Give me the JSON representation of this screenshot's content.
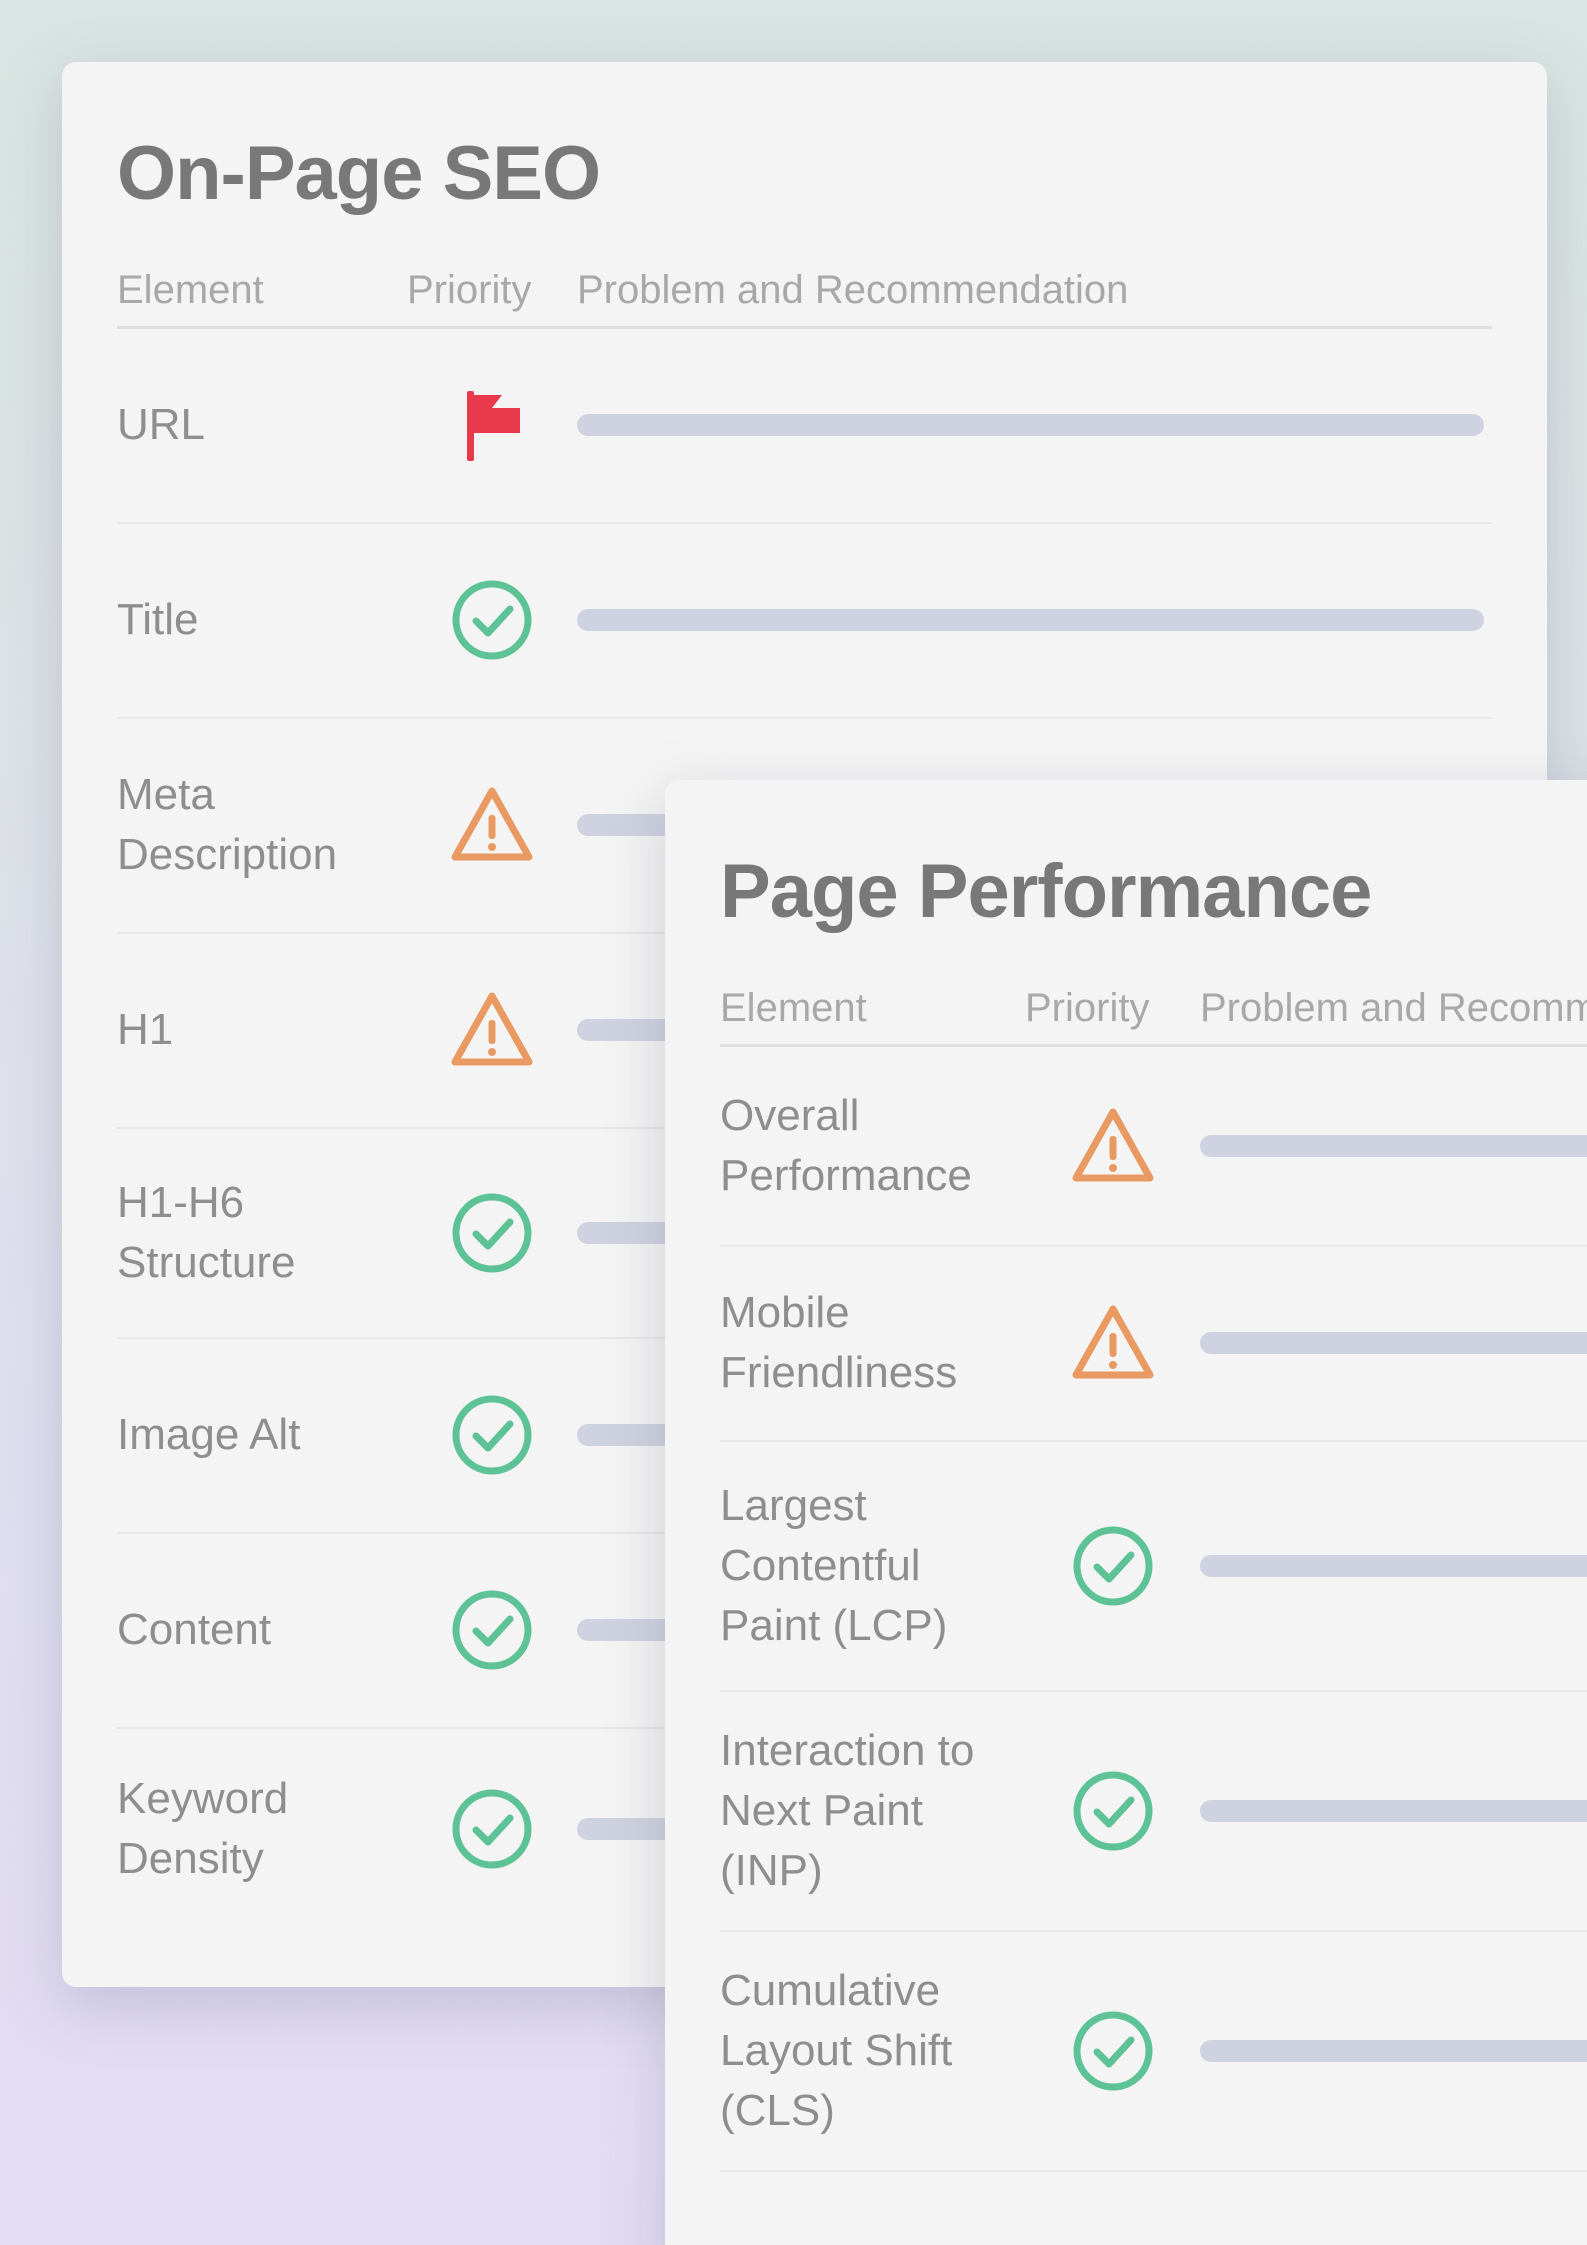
{
  "colors": {
    "flag": "#e83a4c",
    "warning": "#e99a62",
    "ok": "#5ec297",
    "bar": "#cfd2e0"
  },
  "seo": {
    "title": "On-Page SEO",
    "headers": {
      "element": "Element",
      "priority": "Priority",
      "problem": "Problem and Recommendation"
    },
    "rows": [
      {
        "element": "URL",
        "status_icon": "flag-icon"
      },
      {
        "element": "Title",
        "status_icon": "check-circle-icon"
      },
      {
        "element": "Meta Description",
        "status_icon": "warning-triangle-icon"
      },
      {
        "element": "H1",
        "status_icon": "warning-triangle-icon"
      },
      {
        "element": "H1-H6 Structure",
        "status_icon": "check-circle-icon"
      },
      {
        "element": "Image Alt",
        "status_icon": "check-circle-icon"
      },
      {
        "element": "Content",
        "status_icon": "check-circle-icon"
      },
      {
        "element": "Keyword Density",
        "status_icon": "check-circle-icon"
      }
    ]
  },
  "performance": {
    "title": "Page Performance",
    "headers": {
      "element": "Element",
      "priority": "Priority",
      "problem": "Problem and Recommendation"
    },
    "rows": [
      {
        "element": "Overall Performance",
        "status_icon": "warning-triangle-icon"
      },
      {
        "element": "Mobile Friendliness",
        "status_icon": "warning-triangle-icon"
      },
      {
        "element": "Largest Contentful Paint (LCP)",
        "status_icon": "check-circle-icon"
      },
      {
        "element": "Interaction to Next Paint (INP)",
        "status_icon": "check-circle-icon"
      },
      {
        "element": "Cumulative Layout Shift (CLS)",
        "status_icon": "check-circle-icon"
      }
    ]
  }
}
